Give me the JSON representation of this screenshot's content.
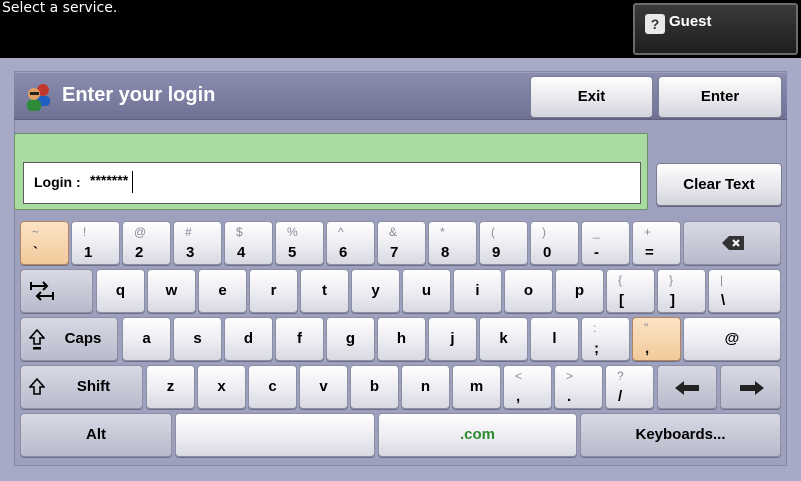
{
  "status": {
    "message": "Select a service."
  },
  "guest": {
    "label": "Guest",
    "icon": "question-icon"
  },
  "header": {
    "title": "Enter your login",
    "icon": "users-icon",
    "exit_label": "Exit",
    "enter_label": "Enter"
  },
  "login": {
    "label": "Login :",
    "value": "*******"
  },
  "clear_label": "Clear Text",
  "keyboard": {
    "row1": [
      {
        "shift": "~",
        "main": "`"
      },
      {
        "shift": "!",
        "main": "1"
      },
      {
        "shift": "@",
        "main": "2"
      },
      {
        "shift": "#",
        "main": "3"
      },
      {
        "shift": "$",
        "main": "4"
      },
      {
        "shift": "%",
        "main": "5"
      },
      {
        "shift": "^",
        "main": "6"
      },
      {
        "shift": "&",
        "main": "7"
      },
      {
        "shift": "*",
        "main": "8"
      },
      {
        "shift": "(",
        "main": "9"
      },
      {
        "shift": ")",
        "main": "0"
      },
      {
        "shift": "_",
        "main": "-"
      },
      {
        "shift": "+",
        "main": "="
      }
    ],
    "row2": [
      "q",
      "w",
      "e",
      "r",
      "t",
      "y",
      "u",
      "i",
      "o",
      "p"
    ],
    "row2_sym": [
      {
        "shift": "{",
        "main": "["
      },
      {
        "shift": "}",
        "main": "]"
      },
      {
        "shift": "|",
        "main": "\\"
      }
    ],
    "row3": [
      "a",
      "s",
      "d",
      "f",
      "g",
      "h",
      "j",
      "k",
      "l"
    ],
    "row3_sym": [
      {
        "shift": ":",
        "main": ";"
      },
      {
        "shift": "\"",
        "main": ","
      }
    ],
    "row3_at": "@",
    "row4": [
      "z",
      "x",
      "c",
      "v",
      "b",
      "n",
      "m"
    ],
    "row4_sym": [
      {
        "shift": "<",
        "main": ","
      },
      {
        "shift": ">",
        "main": "."
      },
      {
        "shift": "?",
        "main": "/"
      }
    ],
    "caps_label": "Caps",
    "shift_label": "Shift",
    "alt_label": "Alt",
    "com_label": ".com",
    "keyboards_label": "Keyboards..."
  },
  "colors": {
    "login_area": "#a8dba0",
    "panel": "#a7aac6",
    "header": "#7a7da0",
    "highlight_key": "#f3c99b",
    "com_text": "#2d8a2d"
  }
}
